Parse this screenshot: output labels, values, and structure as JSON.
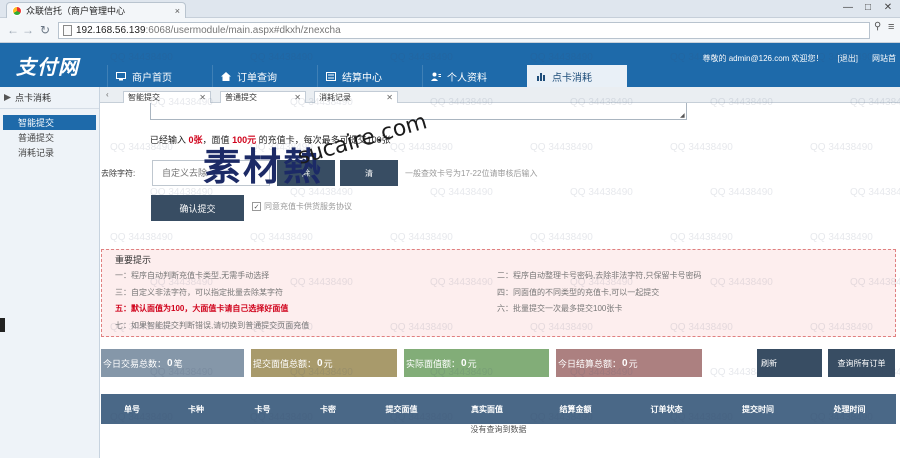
{
  "browser": {
    "tab_title": "众联信托（商户管理中心",
    "tab_close": "×",
    "url_host": "192.168.56.139",
    "url_path": ":6068/usermodule/main.aspx#dkxh/znexcha",
    "win_min": "—",
    "win_max": "□",
    "win_close": "✕"
  },
  "header": {
    "logo": "支付网",
    "nav": [
      {
        "label": "商户首页",
        "icon": "monitor-icon"
      },
      {
        "label": "订单查询",
        "icon": "home-icon"
      },
      {
        "label": "结算中心",
        "icon": "list-icon"
      },
      {
        "label": "个人资料",
        "icon": "user-icon"
      },
      {
        "label": "点卡消耗",
        "icon": "chart-icon"
      }
    ],
    "user_prefix": "尊敬的",
    "user_email": "admin@126.com",
    "welcome": "欢迎您！",
    "logout": "[退出]",
    "site_home": "网站首"
  },
  "sidebar": {
    "title": "点卡消耗",
    "items": [
      "智能提交",
      "普通提交",
      "消耗记录"
    ]
  },
  "content_tabs": [
    "智能提交",
    "普通提交",
    "消耗记录"
  ],
  "main": {
    "info_prefix": "已经输入",
    "info_count": "0张",
    "info_mid": "，面值",
    "info_amount": "100元",
    "info_suffix": "的充值卡，每次最多可提交100张",
    "filter_label": "去除字符:",
    "filter_placeholder": "自定义去除",
    "btn_filter": "除",
    "btn_clear": "清",
    "hint": "一般查效卡号为17-22位请审核后输入",
    "submit": "确认提交",
    "agree_check": "✓",
    "agree_text": "同意充值卡供货服务协议"
  },
  "notice": {
    "title": "重要提示",
    "left": [
      "一：程序自动判断充值卡类型,无需手动选择",
      "三：自定义非法字符，可以指定批量去除某字符",
      "五：默认面值为100，大面值卡请自己选择好面值",
      "七：如果智能提交判断错误,请切换到普通提交页面充值"
    ],
    "right": [
      "二：程序自动整理卡号密码,去除非法字符,只保留卡号密码",
      "四：同面值的不同类型的充值卡,可以一起提交",
      "六：批量提交一次最多提交100张卡"
    ]
  },
  "stats": [
    {
      "label": "今日交易总数：",
      "value": "0",
      "unit": "笔",
      "color": "#8597a9"
    },
    {
      "label": "提交面值总额：",
      "value": "0",
      "unit": "元",
      "color": "#a89a6b"
    },
    {
      "label": "实际面值额：",
      "value": "0",
      "unit": "元",
      "color": "#82ad78"
    },
    {
      "label": "今日结算总额：",
      "value": "0",
      "unit": "元",
      "color": "#ac8080"
    }
  ],
  "buttons": {
    "refresh": "刷新",
    "query_all": "查询所有订单"
  },
  "table": {
    "columns": [
      "单号",
      "卡种",
      "卡号",
      "卡密",
      "提交面值",
      "真实面值",
      "结算金额",
      "订单状态",
      "提交时间",
      "处理时间"
    ],
    "empty": "没有查询到数据"
  },
  "watermark": {
    "cn": "素材熱",
    "en": "sucaire.com",
    "qq": "QQ 34438490"
  },
  "browser_icons": {
    "back": "←",
    "forward": "→",
    "refresh": "↻",
    "pin": "📌",
    "menu": "≡"
  }
}
